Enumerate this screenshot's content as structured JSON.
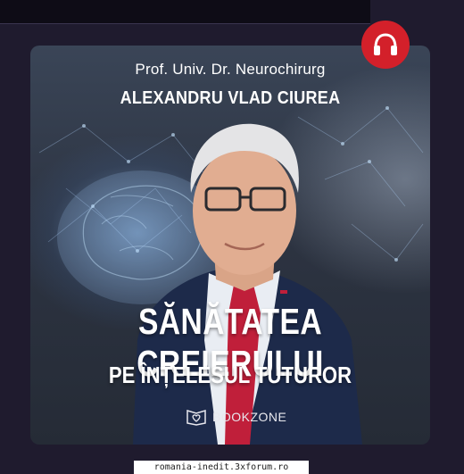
{
  "cover": {
    "subtitle": "Prof. Univ. Dr. Neurochirurg",
    "author": "ALEXANDRU VLAD CIUREA",
    "title": "SĂNĂTATEA CREIERULUI",
    "subtitle2": "PE ÎNȚELESUL TUTUROR",
    "publisher": "BOOKZONE"
  },
  "badge": {
    "icon": "headphones-icon",
    "color": "#d3202a"
  },
  "footer": {
    "url": "romania-inedit.3xforum.ro"
  }
}
